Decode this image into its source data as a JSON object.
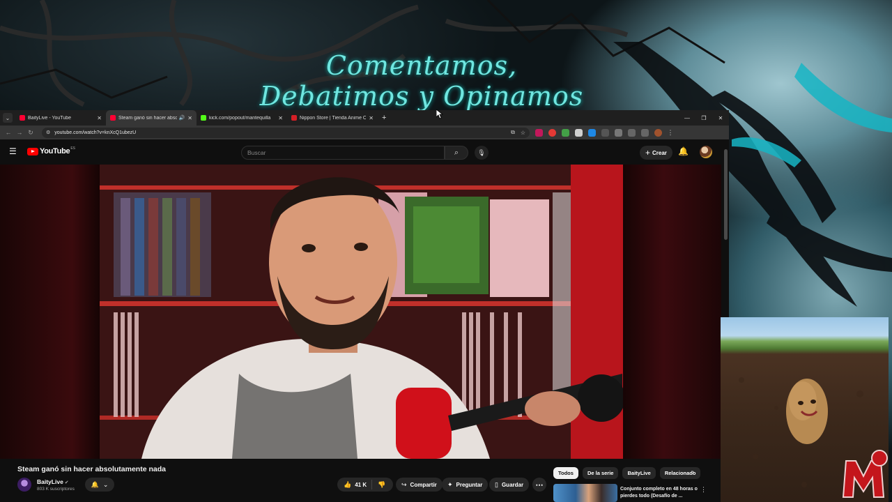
{
  "wallpaper": {
    "title": "Comentamos, Debatimos y Opinamos"
  },
  "browser": {
    "tabs": [
      {
        "title": "BaityLive - YouTube",
        "favicon_color": "#ff0033",
        "active": false,
        "audio": false
      },
      {
        "title": "Steam ganó sin hacer absolutamente nada",
        "favicon_color": "#ff0033",
        "active": true,
        "audio": true
      },
      {
        "title": "kick.com/popout/mantequilla",
        "favicon_color": "#53fc18",
        "active": false,
        "audio": false
      },
      {
        "title": "Nippon Store | Tienda Anime O",
        "favicon_color": "#d61f26",
        "active": false,
        "audio": false
      }
    ],
    "url": "youtube.com/watch?v=knXcQ1ubezU"
  },
  "youtube": {
    "logo_text": "YouTube",
    "logo_country": "ES",
    "search_placeholder": "Buscar",
    "create_label": "Crear",
    "video": {
      "title": "Steam ganó sin hacer absolutamente nada",
      "channel": "BaityLive",
      "subscribers": "803 K suscriptores",
      "likes": "41 K",
      "share_label": "Compartir",
      "ask_label": "Preguntar",
      "save_label": "Guardar"
    },
    "chips": [
      "Todos",
      "De la serie",
      "BaityLive",
      "Relacionado"
    ],
    "selected_chip": "Todos",
    "recommendation": {
      "title": "Conjunto completo en 48 horas o pierdes todo (Desafío de ..."
    }
  },
  "colors": {
    "accent_red": "#ff0000",
    "wall_title": "#6fe6e0"
  }
}
